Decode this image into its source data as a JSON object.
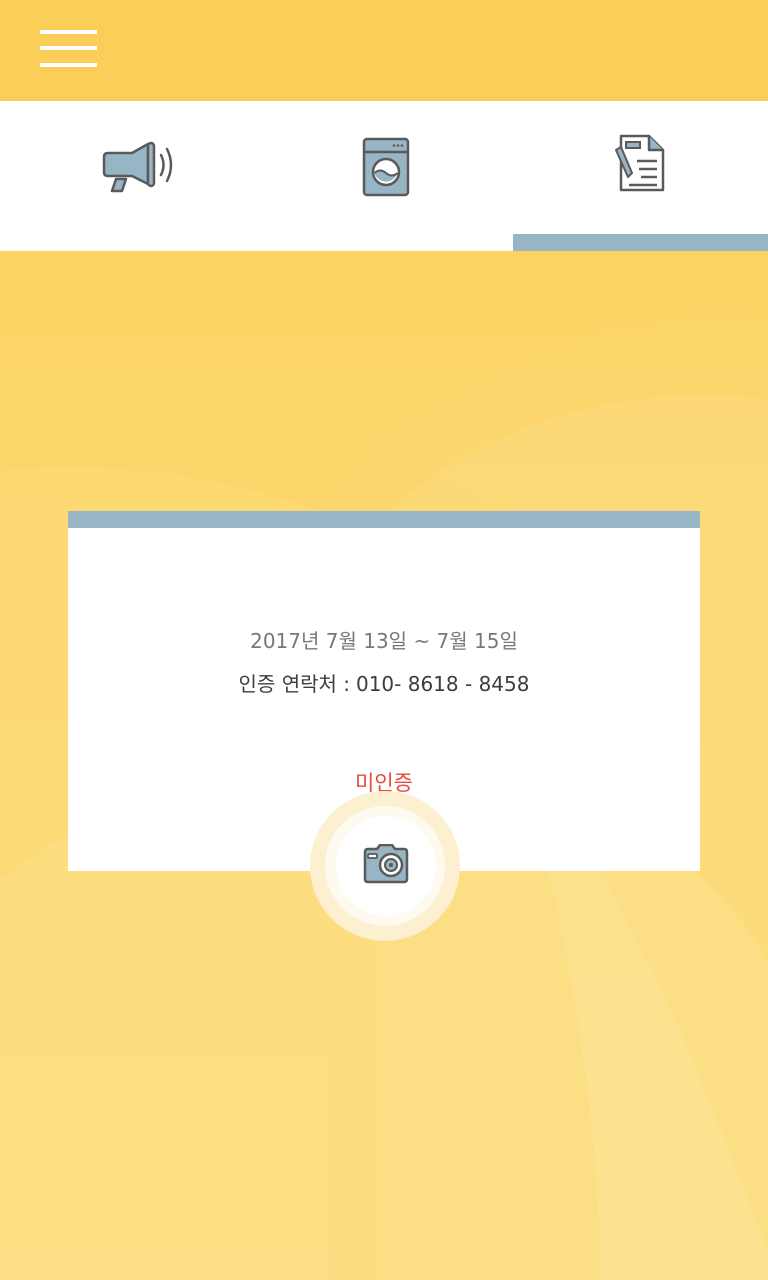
{
  "header": {
    "menu_icon": "hamburger-menu-icon",
    "background_color": "#fbcf57"
  },
  "tabs": [
    {
      "id": "notice",
      "icon": "megaphone-icon",
      "selected": false
    },
    {
      "id": "laundry",
      "icon": "washing-machine-icon",
      "selected": false
    },
    {
      "id": "document",
      "icon": "document-edit-icon",
      "selected": true
    }
  ],
  "accent_color": "#97b5c5",
  "card": {
    "period": "2017년  7월 13일 ~ 7월 15일",
    "contact_label": "인증 연락처 :",
    "contact_number": "010- 8618 - 8458",
    "status": "미인증",
    "status_color": "#e74c3c"
  },
  "camera": {
    "icon": "camera-icon"
  }
}
